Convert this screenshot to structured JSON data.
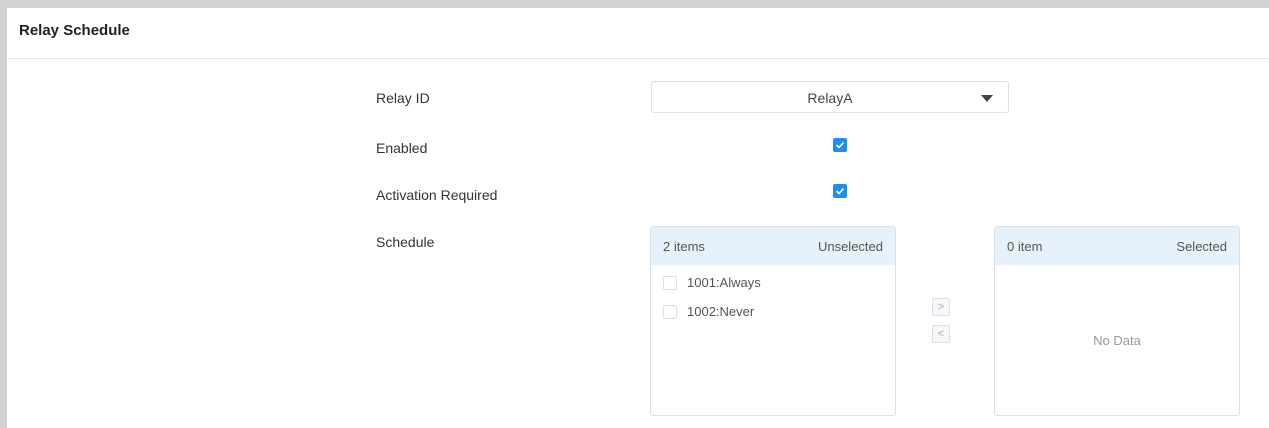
{
  "panel": {
    "title": "Relay Schedule"
  },
  "form": {
    "relay_id_label": "Relay ID",
    "relay_id_value": "RelayA",
    "enabled_label": "Enabled",
    "enabled_checked": true,
    "activation_label": "Activation Required",
    "activation_checked": true,
    "schedule_label": "Schedule"
  },
  "transfer": {
    "left": {
      "count": "2 items",
      "title": "Unselected",
      "items": [
        {
          "label": "1001:Always",
          "checked": false
        },
        {
          "label": "1002:Never",
          "checked": false
        }
      ]
    },
    "right": {
      "count": "0 item",
      "title": "Selected",
      "empty_text": "No Data"
    },
    "move_right_icon": ">",
    "move_left_icon": "<"
  },
  "colors": {
    "accent": "#1f8ef1",
    "list_header_bg": "#e6f1fc",
    "page_bg": "#d2d2d2"
  }
}
